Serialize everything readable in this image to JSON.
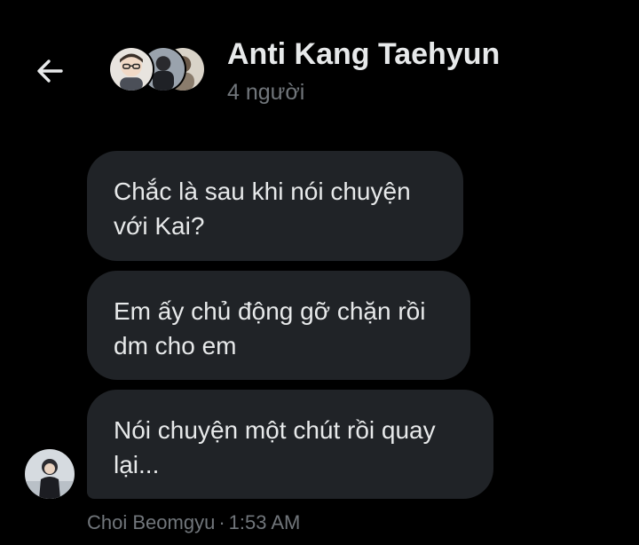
{
  "header": {
    "title": "Anti Kang Taehyun",
    "member_count": "4 người",
    "back_icon": "arrow-left-icon"
  },
  "messages": [
    {
      "text_line1": "Chắc là sau khi nói chuyện",
      "text_line2": "với Kai?"
    },
    {
      "text_line1": "Em ấy chủ động gỡ chặn rồi",
      "text_line2": "dm cho em"
    },
    {
      "text_line1": "Nói chuyện một chút rồi quay",
      "text_line2": "lại..."
    }
  ],
  "footer": {
    "sender": "Choi Beomgyu",
    "separator": "·",
    "time": "1:53 AM"
  },
  "colors": {
    "background": "#000000",
    "bubble": "#202327",
    "text": "#e7e9ea",
    "muted": "#71767b"
  }
}
